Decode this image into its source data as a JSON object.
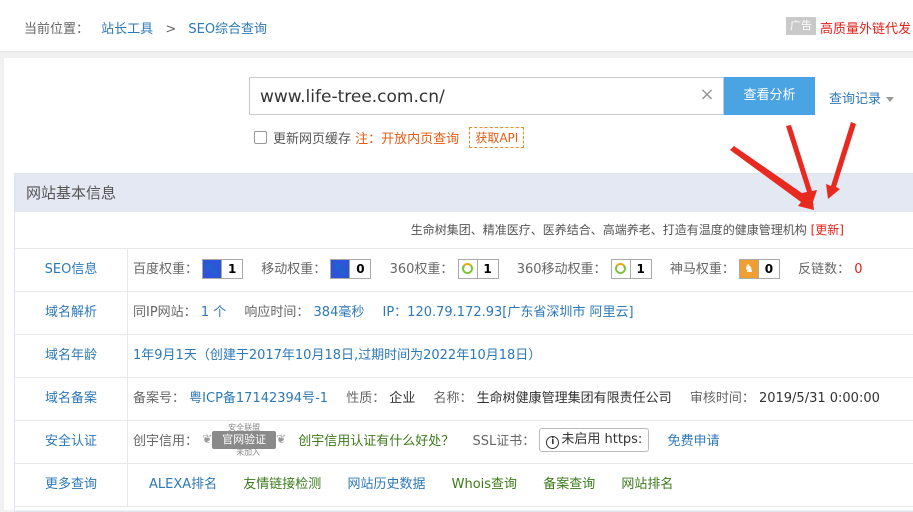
{
  "breadcrumb": {
    "label": "当前位置：",
    "home": "站长工具",
    "separator": ">",
    "current": "SEO综合查询"
  },
  "ad": {
    "tag": "广告",
    "text": "高质量外链代发"
  },
  "search": {
    "value": "www.life-tree.com.cn/",
    "clear_icon": "×",
    "button": "查看分析",
    "history": "查询记录"
  },
  "cache": {
    "label": "更新网页缓存",
    "note": "注：开放内页查询",
    "api": "获取API"
  },
  "section": {
    "title": "网站基本信息",
    "description": "生命树集团、精准医疗、医养结合、高端养老、打造有温度的健康管理机构",
    "update": "[更新]"
  },
  "seo": {
    "label": "SEO信息",
    "baidu_label": "百度权重：",
    "baidu_value": "1",
    "mobile_label": "移动权重：",
    "mobile_value": "0",
    "q360_label": "360权重：",
    "q360_value": "1",
    "q360m_label": "360移动权重：",
    "q360m_value": "1",
    "shenma_label": "神马权重：",
    "shenma_value": "0",
    "backlinks_label": "反链数：",
    "backlinks_value": "0"
  },
  "dns": {
    "label": "域名解析",
    "sameip_label": "同IP网站：",
    "sameip_value": "1 个",
    "response_label": "响应时间：",
    "response_value": "384毫秒",
    "ip_text": "IP：120.79.172.93[广东省深圳市 阿里云]"
  },
  "age": {
    "label": "域名年龄",
    "text": "1年9月1天（创建于2017年10月18日,过期时间为2022年10月18日）"
  },
  "icp": {
    "label": "域名备案",
    "no_label": "备案号：",
    "no_value": "粤ICP备17142394号-1",
    "type_label": "性质：",
    "type_value": "企业",
    "name_label": "名称：",
    "name_value": "生命树健康管理集团有限责任公司",
    "date_label": "审核时间：",
    "date_value": "2019/5/31 0:00:00"
  },
  "security": {
    "label": "安全认证",
    "chuangyu_label": "创宇信用：",
    "badge_top": "安全联盟",
    "badge_text": "官网验证",
    "badge_sub": "未加入",
    "chuangyu_link": "创宇信用认证有什么好处？",
    "ssl_label": "SSL证书：",
    "ssl_status": "未启用 https:",
    "ssl_apply": "免费申请"
  },
  "more": {
    "label": "更多查询",
    "links": [
      "ALEXA排名",
      "友情链接检测",
      "网站历史数据",
      "Whois查询",
      "备案查询",
      "网站排名"
    ]
  },
  "colors": {
    "accent": "#4aa4e4",
    "link": "#2d78b8",
    "alert": "#e2211c",
    "section_bg": "#e4e8f2"
  }
}
